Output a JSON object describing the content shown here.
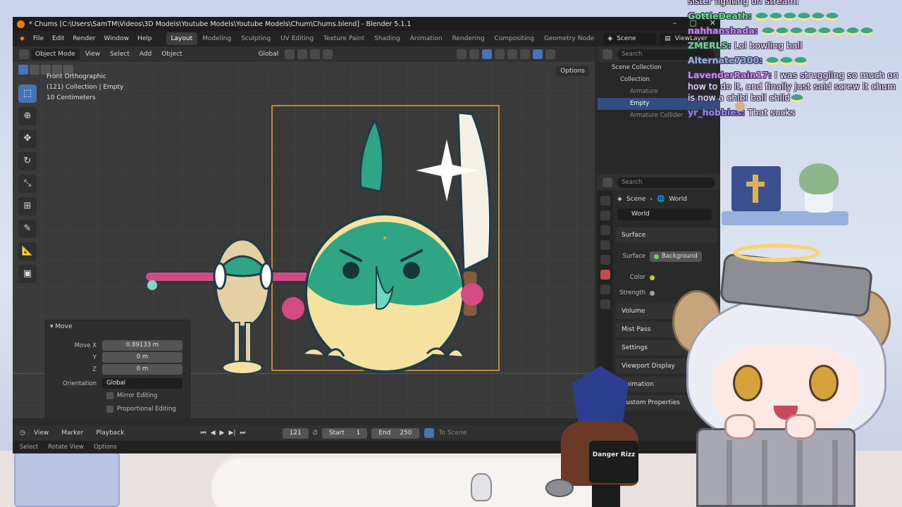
{
  "blender": {
    "title": "* Chums [C:\\Users\\SamTM\\Videos\\3D Models\\Youtube Models\\Youtube Models\\Chum\\Chums.blend] - Blender 5.1.1",
    "menu": [
      "File",
      "Edit",
      "Render",
      "Window",
      "Help"
    ],
    "workspaces": [
      "Layout",
      "Modeling",
      "Sculpting",
      "UV Editing",
      "Texture Paint",
      "Shading",
      "Animation",
      "Rendering",
      "Compositing",
      "Geometry Node"
    ],
    "active_workspace": "Layout",
    "scene_label": "Scene",
    "view_layer_label": "ViewLayer",
    "viewport": {
      "mode": "Object Mode",
      "menu": [
        "View",
        "Select",
        "Add",
        "Object"
      ],
      "transform_orientation": "Global",
      "options_label": "Options",
      "info_view": "Front Orthographic",
      "info_collection": "(121) Collection | Empty",
      "info_scale": "10 Centimeters"
    },
    "move_panel": {
      "title": "Move",
      "move_x_label": "Move X",
      "move_x_value": "0.89133 m",
      "y_label": "Y",
      "y_value": "0 m",
      "z_label": "Z",
      "z_value": "0 m",
      "orientation_label": "Orientation",
      "orientation_value": "Global",
      "mirror_editing": "Mirror Editing",
      "proportional_editing": "Proportional Editing"
    },
    "timeline": {
      "menu": [
        "View",
        "Marker",
        "Playback"
      ],
      "current_frame": "121",
      "start_label": "Start",
      "start_value": "1",
      "end_label": "End",
      "end_value": "250",
      "to_scene": "To Scene"
    },
    "status": {
      "select": "Select",
      "rotate_view": "Rotate View",
      "options": "Options"
    },
    "outliner": {
      "search_placeholder": "Search",
      "rows": [
        {
          "label": "Scene Collection",
          "indent": 0,
          "state": "normal"
        },
        {
          "label": "Collection",
          "indent": 1,
          "state": "normal"
        },
        {
          "label": "Armature",
          "indent": 2,
          "state": "dim"
        },
        {
          "label": "Empty",
          "indent": 2,
          "state": "selected"
        },
        {
          "label": "Armature Collider",
          "indent": 2,
          "state": "dim"
        }
      ]
    },
    "properties": {
      "search_placeholder": "Search",
      "breadcrumb_scene": "Scene",
      "breadcrumb_world": "World",
      "world_name": "World",
      "surface_panel": "Surface",
      "surface_label": "Surface",
      "surface_value": "Background",
      "color_label": "Color",
      "strength_label": "Strength",
      "collapsed_panels": [
        "Volume",
        "Mist Pass",
        "Settings",
        "Viewport Display",
        "Animation",
        "Custom Properties"
      ]
    }
  },
  "chat": [
    {
      "user": "",
      "color": "#ffffff",
      "text": "sister fighting on stream:",
      "emotes": 0
    },
    {
      "user": "GottieDeath:",
      "color": "#63e07a",
      "text": "",
      "emotes": 6
    },
    {
      "user": "nahhanshada:",
      "color": "#c68be8",
      "text": "",
      "emotes": 8
    },
    {
      "user": "ZMERLS:",
      "color": "#63e07a",
      "text": "Lol bowling ball",
      "emotes": 0,
      "faces": 2
    },
    {
      "user": "Alternate7300:",
      "color": "#8fb8d8",
      "text": "",
      "emotes": 3
    },
    {
      "user": "LavenderRain17:",
      "color": "#c68be8",
      "text": "I was struggling so much on how to do it, and finally just said screw it chum is now a chibi ball child",
      "emotes": 1
    },
    {
      "user": "yr_hobbies:",
      "color": "#8d86e0",
      "text": "That sucks",
      "emotes": 0
    }
  ],
  "mascot_shirt_text": "Danger Rizz",
  "colors": {
    "blender_accent": "#4772b3",
    "selection_orange": "#e8a33a",
    "chum_teal": "#2fa583",
    "chum_belly": "#f4e29e"
  }
}
